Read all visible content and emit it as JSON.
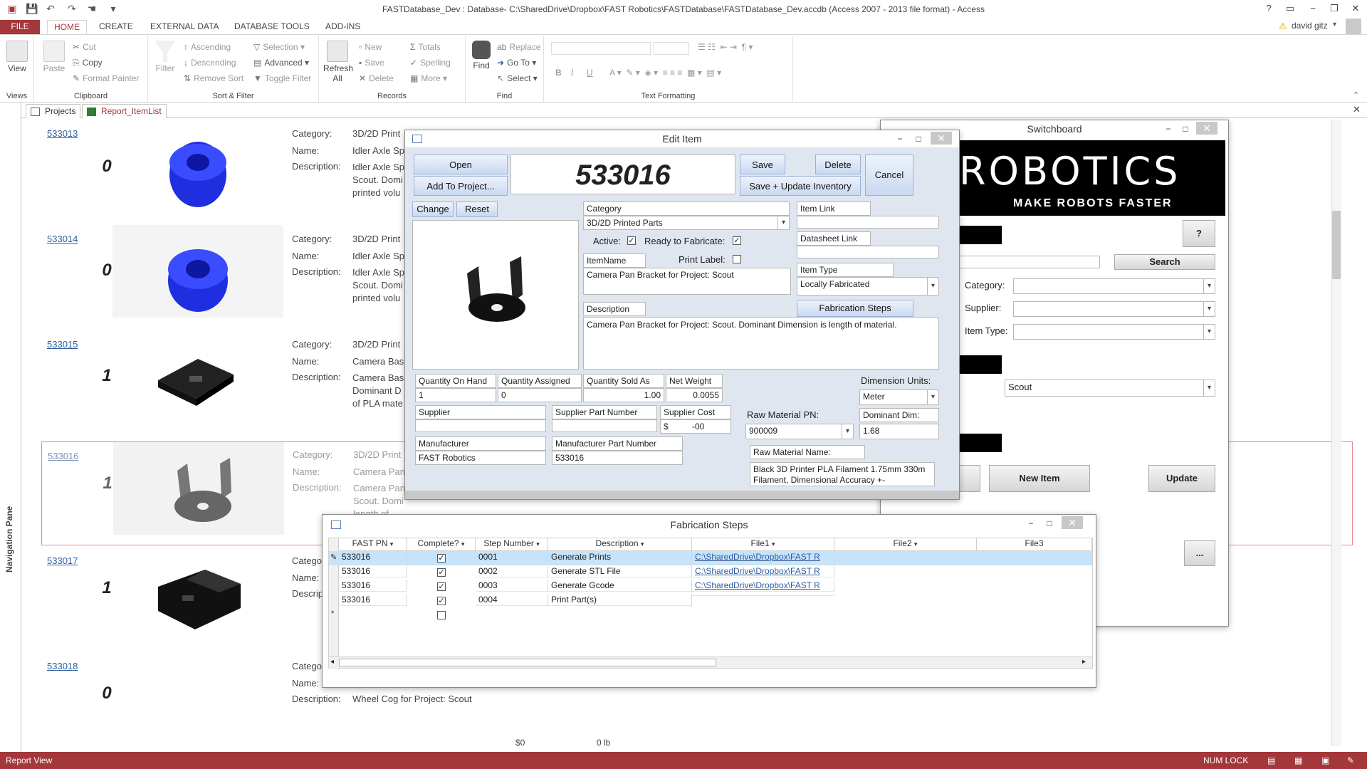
{
  "titlebar": {
    "title": "FASTDatabase_Dev : Database- C:\\SharedDrive\\Dropbox\\FAST Robotics\\FASTDatabase\\FASTDatabase_Dev.accdb (Access 2007 - 2013 file format) - Access",
    "help": "?",
    "min": "−",
    "restore": "❐",
    "close": "✕"
  },
  "ribbon_tabs": [
    "FILE",
    "HOME",
    "CREATE",
    "EXTERNAL DATA",
    "DATABASE TOOLS",
    "ADD-INS"
  ],
  "user": {
    "name": "david gitz"
  },
  "ribbon": {
    "views": {
      "view": "View",
      "label": "Views"
    },
    "clipboard": {
      "paste": "Paste",
      "cut": "Cut",
      "copy": "Copy",
      "format_painter": "Format Painter",
      "label": "Clipboard"
    },
    "sortfilter": {
      "filter": "Filter",
      "ascending": "Ascending",
      "descending": "Descending",
      "remove_sort": "Remove Sort",
      "selection": "Selection",
      "advanced": "Advanced",
      "toggle_filter": "Toggle Filter",
      "label": "Sort & Filter"
    },
    "records": {
      "refresh": "Refresh",
      "refresh2": "All",
      "new": "New",
      "save": "Save",
      "delete": "Delete",
      "totals": "Totals",
      "spelling": "Spelling",
      "more": "More",
      "label": "Records"
    },
    "find": {
      "find": "Find",
      "replace": "Replace",
      "goto": "Go To",
      "select": "Select",
      "label": "Find"
    },
    "textformat": {
      "label": "Text Formatting",
      "bold": "B",
      "italic": "I",
      "underline": "U"
    }
  },
  "doc_tabs": [
    "Projects",
    "Report_ItemList"
  ],
  "nav_pane": "Navigation Pane",
  "report_rows": [
    {
      "pn": "533013",
      "qty": "0",
      "category": "3D/2D Print",
      "name": "Idler Axle Sp",
      "desc": "Idler Axle Sp Scout. Domi printed volu"
    },
    {
      "pn": "533014",
      "qty": "0",
      "category": "3D/2D Print",
      "name": "Idler Axle Sp",
      "desc": "Idler Axle Sp Scout. Domi printed volu"
    },
    {
      "pn": "533015",
      "qty": "1",
      "category": "3D/2D Print",
      "name": "Camera Bas",
      "desc": "Camera Bas Dominant D of PLA mate"
    },
    {
      "pn": "533016",
      "qty": "1",
      "category": "3D/2D Print",
      "name": "Camera Pan",
      "desc": "Camera Pan Scout. Domi length of material."
    },
    {
      "pn": "533017",
      "qty": "1",
      "category": "",
      "name": "",
      "desc": ""
    },
    {
      "pn": "533018",
      "qty": "0",
      "category": "",
      "name": "",
      "desc": "Wheel Cog for Project: Scout"
    }
  ],
  "report_labels": {
    "category": "Category:",
    "name": "Name:",
    "description": "Description:",
    "cat_short": "Catego",
    "name_short": "Name:",
    "desc_short": "Descrip"
  },
  "report_footer": {
    "a": "$0",
    "b": "0 lb"
  },
  "edit_item": {
    "title": "Edit Item",
    "open": "Open",
    "add_to_project": "Add To Project...",
    "item_number": "533016",
    "save": "Save",
    "delete": "Delete",
    "save_update": "Save + Update Inventory",
    "cancel": "Cancel",
    "change": "Change",
    "reset": "Reset",
    "category_label": "Category",
    "category_value": "3D/2D Printed Parts",
    "active_label": "Active:",
    "ready_label": "Ready to Fabricate:",
    "print_label": "Print Label:",
    "itemname_label": "ItemName",
    "itemname_value": "Camera Pan Bracket for Project: Scout",
    "description_label": "Description",
    "description_value": "Camera Pan Bracket for Project: Scout. Dominant Dimension is length of material.",
    "item_link_label": "Item Link",
    "datasheet_label": "Datasheet Link",
    "item_type_label": "Item Type",
    "item_type_value": "Locally Fabricated",
    "fab_steps_btn": "Fabrication Steps",
    "qoh_label": "Quantity On Hand",
    "qoh": "1",
    "qa_label": "Quantity Assigned",
    "qa": "0",
    "qsa_label": "Quantity Sold As",
    "qsa": "1.00",
    "nw_label": "Net Weight",
    "nw": "0.0055",
    "dim_units_label": "Dimension Units:",
    "dim_units": "Meter",
    "supplier_label": "Supplier",
    "supplier_pn_label": "Supplier Part Number",
    "supplier_cost_label": "Supplier Cost",
    "supplier_cost": "$          -00",
    "raw_pn_label": "Raw Material PN:",
    "raw_pn": "900009",
    "dom_dim_label": "Dominant Dim:",
    "dom_dim": "1.68",
    "manufacturer_label": "Manufacturer",
    "manufacturer": "FAST Robotics",
    "mfr_pn_label": "Manufacturer Part Number",
    "mfr_pn": "533016",
    "raw_name_label": "Raw Material Name:",
    "raw_name": "Black 3D Printer PLA Filament 1.75mm 330m Filament, Dimensional Accuracy +-"
  },
  "switchboard": {
    "title": "Switchboard",
    "logo_line1": "ROBOTICS",
    "logo_line2": "MAKE ROBOTS FASTER",
    "help": "?",
    "search": "Search",
    "category_label": "Category:",
    "supplier_label": "Supplier:",
    "item_type_label": "Item Type:",
    "project_value": "Scout",
    "new_item": "New Item",
    "update": "Update",
    "more": "..."
  },
  "fab_steps": {
    "title": "Fabrication Steps",
    "columns": [
      "FAST PN",
      "Complete?",
      "Step Number",
      "Description",
      "File1",
      "File2",
      "File3"
    ],
    "rows": [
      {
        "pn": "533016",
        "complete": true,
        "step": "0001",
        "desc": "Generate Prints",
        "file1": "C:\\SharedDrive\\Dropbox\\FAST R"
      },
      {
        "pn": "533016",
        "complete": true,
        "step": "0002",
        "desc": "Generate STL File",
        "file1": "C:\\SharedDrive\\Dropbox\\FAST R"
      },
      {
        "pn": "533016",
        "complete": true,
        "step": "0003",
        "desc": "Generate Gcode",
        "file1": "C:\\SharedDrive\\Dropbox\\FAST R"
      },
      {
        "pn": "533016",
        "complete": true,
        "step": "0004",
        "desc": "Print Part(s)",
        "file1": ""
      }
    ]
  },
  "status": {
    "view": "Report View",
    "numlock": "NUM LOCK"
  },
  "colors": {
    "accent": "#a4373a",
    "link": "#2f5e9e",
    "part_blue": "#1f2fe0",
    "part_black": "#111111",
    "part_grey": "#6b6b6b"
  }
}
